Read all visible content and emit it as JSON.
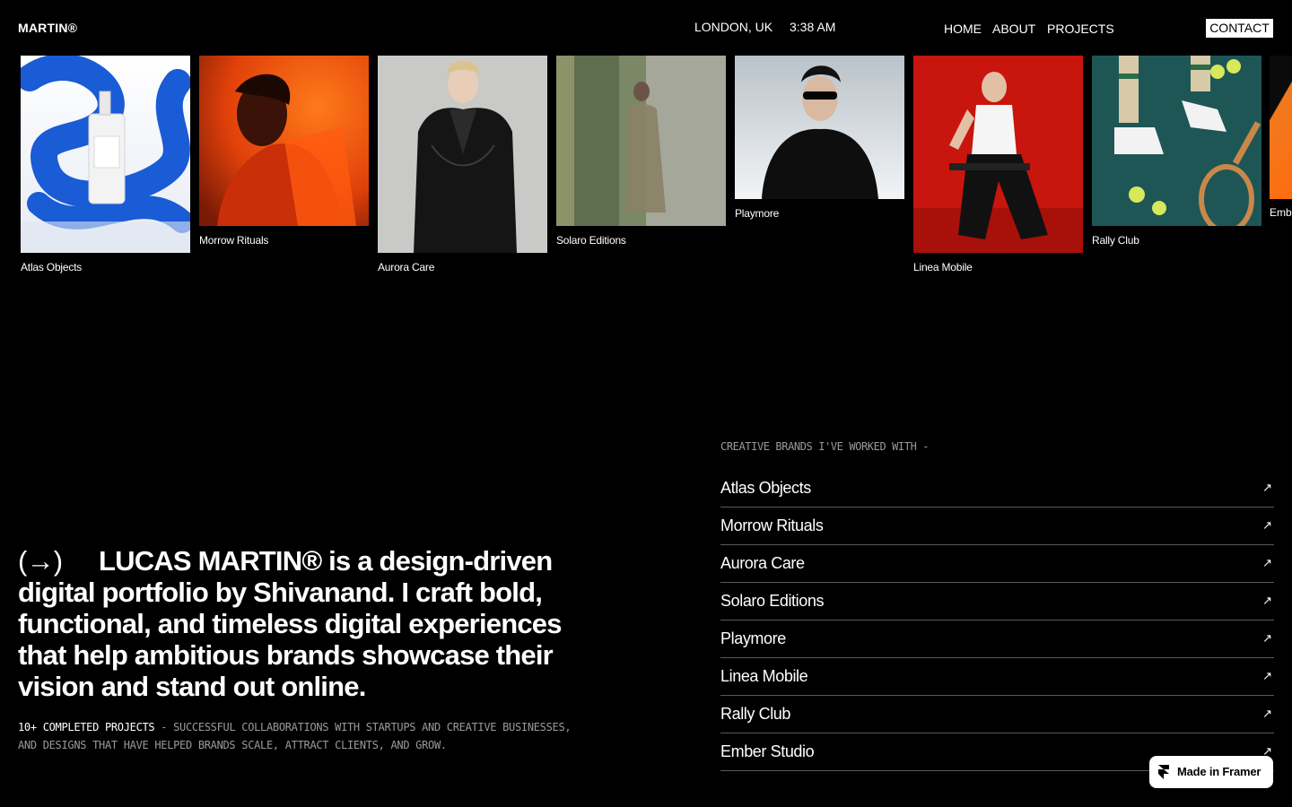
{
  "header": {
    "logo": "MARTIN®",
    "location": "LONDON, UK",
    "time": "3:38 AM",
    "nav": [
      "HOME",
      "ABOUT",
      "PROJECTS"
    ],
    "contact": "CONTACT"
  },
  "gallery": [
    {
      "caption": "Atlas Objects"
    },
    {
      "caption": "Morrow Rituals"
    },
    {
      "caption": "Aurora Care"
    },
    {
      "caption": "Solaro Editions"
    },
    {
      "caption": "Playmore"
    },
    {
      "caption": "Linea Mobile"
    },
    {
      "caption": "Rally Club"
    },
    {
      "caption": "Emb"
    }
  ],
  "intro": {
    "arrow": "(→)",
    "text": "LUCAS MARTIN® is a design-driven digital portfolio by Shivanand. I craft bold, functional, and timeless digital experiences that help ambitious brands showcase their vision and stand out online.",
    "sub_lead": "10+ COMPLETED PROJECTS",
    "sub_rest": " - SUCCESSFUL COLLABORATIONS WITH STARTUPS AND CREATIVE BUSINESSES, AND DESIGNS THAT HAVE HELPED BRANDS SCALE, ATTRACT CLIENTS, AND GROW."
  },
  "brands": {
    "title": "CREATIVE BRANDS I'VE WORKED WITH -",
    "items": [
      "Atlas Objects",
      "Morrow Rituals",
      "Aurora Care",
      "Solaro Editions",
      "Playmore",
      "Linea Mobile",
      "Rally Club",
      "Ember Studio"
    ],
    "arrow": "↗"
  },
  "badge": {
    "label": "Made in Framer"
  }
}
